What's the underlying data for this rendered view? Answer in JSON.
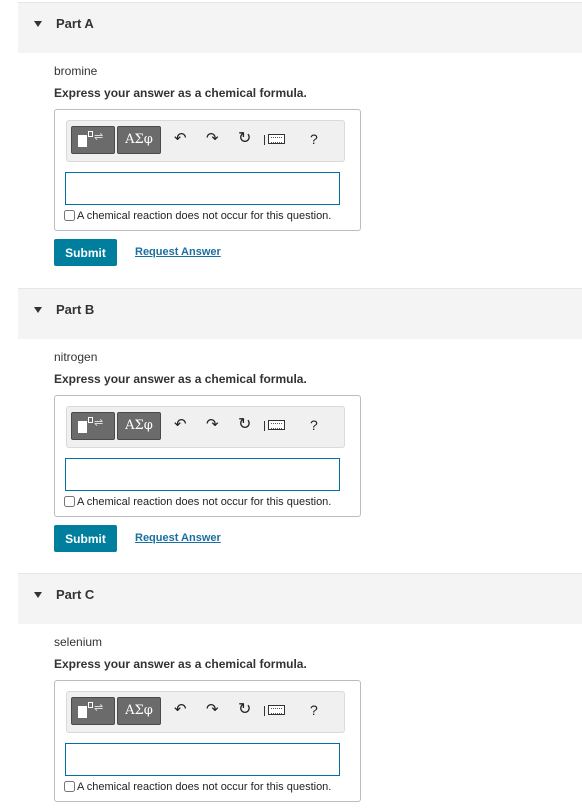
{
  "parts": [
    {
      "title": "Part A",
      "element": "bromine",
      "instruction": "Express your answer as a chemical formula.",
      "answer_value": "",
      "no_reaction_label": "A chemical reaction does not occur for this question.",
      "submit_label": "Submit",
      "request_label": "Request Answer"
    },
    {
      "title": "Part B",
      "element": "nitrogen",
      "instruction": "Express your answer as a chemical formula.",
      "answer_value": "",
      "no_reaction_label": "A chemical reaction does not occur for this question.",
      "submit_label": "Submit",
      "request_label": "Request Answer"
    },
    {
      "title": "Part C",
      "element": "selenium",
      "instruction": "Express your answer as a chemical formula.",
      "answer_value": "",
      "no_reaction_label": "A chemical reaction does not occur for this question."
    }
  ],
  "toolbar": {
    "symbols_label": "ΑΣφ",
    "help_label": "?",
    "icons": [
      "templates-icon",
      "greek-symbols-icon",
      "undo-icon",
      "redo-icon",
      "reset-icon",
      "keyboard-icon",
      "help-icon"
    ]
  },
  "colors": {
    "header_bg": "#f4f4f4",
    "submit_bg": "#007e9e",
    "link": "#1a6fa0",
    "input_border": "#006fa6",
    "toolbar_button": "#6b6b6b"
  }
}
